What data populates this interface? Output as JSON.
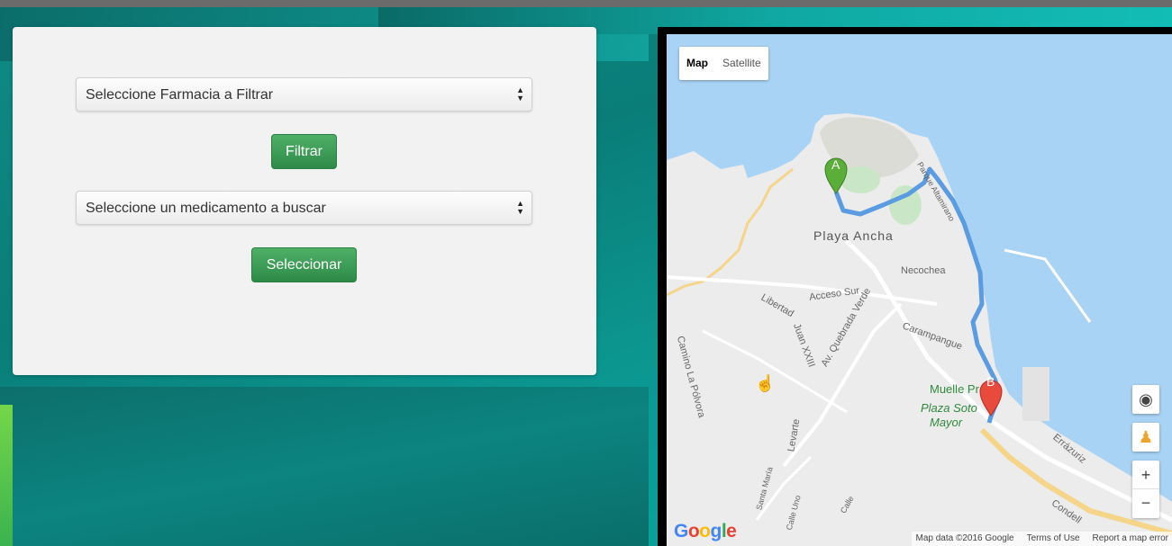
{
  "form": {
    "pharmacy_select": {
      "value": "Seleccione Farmacia a Filtrar"
    },
    "filter_button": "Filtrar",
    "medicine_select": {
      "value": "Seleccione un medicamento a buscar"
    },
    "select_button": "Seleccionar"
  },
  "map": {
    "type_controls": {
      "map": "Map",
      "satellite": "Satellite"
    },
    "markers": {
      "start": "A",
      "end": "B"
    },
    "labels": {
      "district": "Playa Ancha",
      "street_necochea": "Necochea",
      "street_acceso_sur": "Acceso Sur",
      "street_libertad": "Libertad",
      "street_juan_xxiii": "Juan XXIII",
      "street_quebrada_verde": "Av. Quebrada Verde",
      "street_carampangue": "Carampangue",
      "street_levarte": "Levarte",
      "street_la_polvora": "Camino La Pólvora",
      "street_errazuriz": "Errázuriz",
      "street_condell": "Condell",
      "street_altamirano": "Parque Altamirano",
      "street_calle_uno": "Calle Uno",
      "street_santa_maria": "Santa María",
      "street_calle": "Calle"
    },
    "pois": {
      "muelle": "Muelle Pr",
      "plaza_line1": "Plaza Soto",
      "plaza_line2": "Mayor"
    },
    "controls": {
      "zoom_in": "+",
      "zoom_out": "−"
    },
    "footer": {
      "data": "Map data ©2016 Google",
      "terms": "Terms of Use",
      "report": "Report a map error"
    },
    "logo": "Google",
    "colors": {
      "route": "#5a9be2",
      "marker_a": "#5cae3a",
      "marker_b": "#e84a3c",
      "water": "#a9d3f5",
      "land": "#ececec"
    }
  }
}
